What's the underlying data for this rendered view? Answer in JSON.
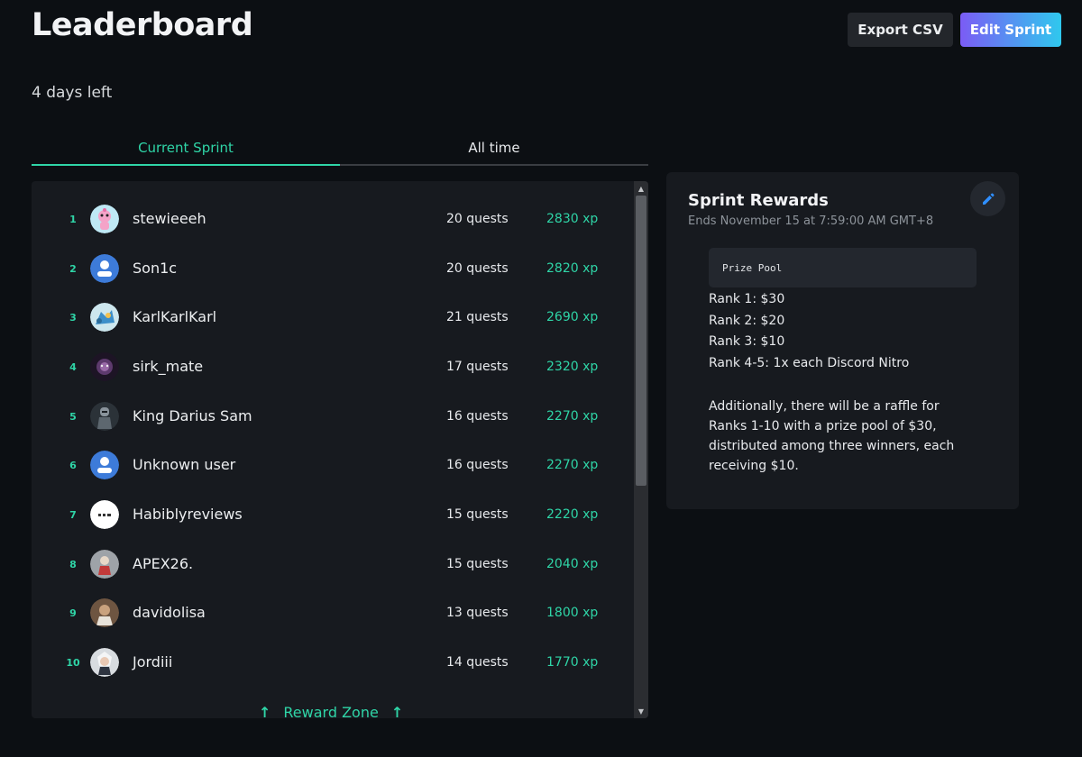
{
  "header": {
    "title": "Leaderboard",
    "subtitle": "4 days left",
    "export_label": "Export CSV",
    "edit_label": "Edit Sprint"
  },
  "tabs": [
    {
      "label": "Current Sprint",
      "active": true
    },
    {
      "label": "All time",
      "active": false
    }
  ],
  "leaderboard": {
    "rows": [
      {
        "rank": "1",
        "name": "stewieeeh",
        "quests": "20 quests",
        "xp": "2830 xp",
        "avatar": "pink-character-avatar"
      },
      {
        "rank": "2",
        "name": "Son1c",
        "quests": "20 quests",
        "xp": "2820 xp",
        "avatar": "default-user-avatar"
      },
      {
        "rank": "3",
        "name": "KarlKarlKarl",
        "quests": "21 quests",
        "xp": "2690 xp",
        "avatar": "blue-creature-avatar"
      },
      {
        "rank": "4",
        "name": "sirk_mate",
        "quests": "17 quests",
        "xp": "2320 xp",
        "avatar": "dark-purple-avatar"
      },
      {
        "rank": "5",
        "name": "King Darius Sam",
        "quests": "16 quests",
        "xp": "2270 xp",
        "avatar": "armored-figure-avatar"
      },
      {
        "rank": "6",
        "name": "Unknown user",
        "quests": "16 quests",
        "xp": "2270 xp",
        "avatar": "default-user-avatar"
      },
      {
        "rank": "7",
        "name": "Habiblyreviews",
        "quests": "15 quests",
        "xp": "2220 xp",
        "avatar": "white-logo-avatar"
      },
      {
        "rank": "8",
        "name": "APEX26.",
        "quests": "15 quests",
        "xp": "2040 xp",
        "avatar": "grey-figure-avatar"
      },
      {
        "rank": "9",
        "name": "davidolisa",
        "quests": "13 quests",
        "xp": "1800 xp",
        "avatar": "brown-portrait-avatar"
      },
      {
        "rank": "10",
        "name": "Jordiii",
        "quests": "14 quests",
        "xp": "1770 xp",
        "avatar": "silver-character-avatar"
      }
    ],
    "reward_zone_label": "Reward Zone"
  },
  "rewards": {
    "title": "Sprint Rewards",
    "ends": "Ends November 15 at 7:59:00 AM GMT+8",
    "prize_pool_label": "Prize Pool",
    "ranks": [
      "Rank 1: $30",
      "Rank 2: $20",
      "Rank 3: $10",
      "Rank 4-5: 1x each Discord Nitro"
    ],
    "raffle": "Additionally, there will be a raffle for Ranks 1-10 with a prize pool of $30, distributed among three winners, each receiving $10."
  },
  "colors": {
    "accent": "#2fd5a7",
    "background": "#0c0f13",
    "panel": "#171a1f",
    "edit_gradient_start": "#7b5cf5",
    "edit_gradient_end": "#2fc8ee"
  }
}
